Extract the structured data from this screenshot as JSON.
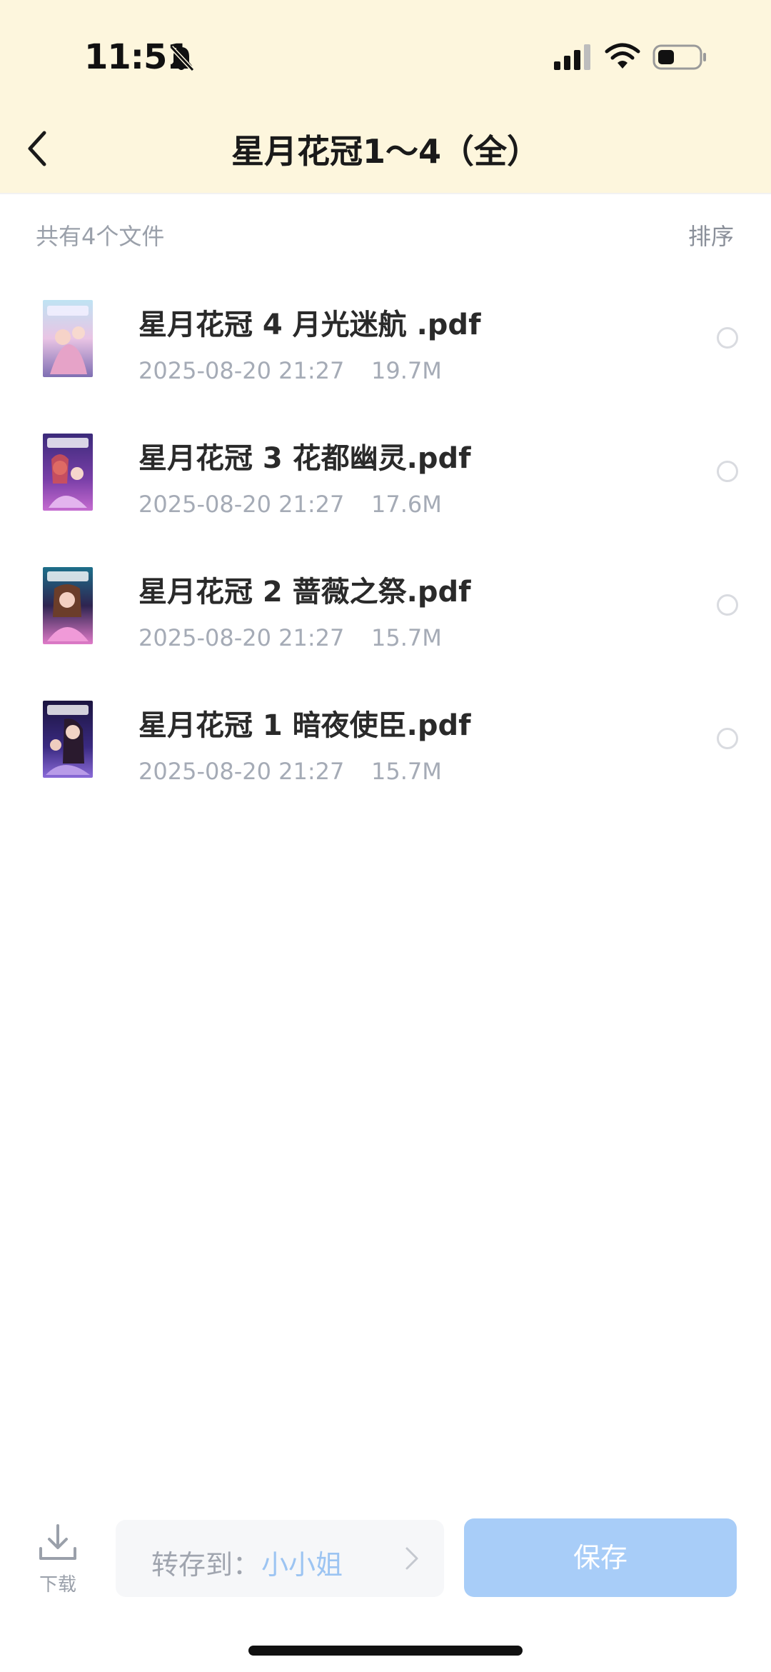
{
  "status_bar": {
    "time": "11:51",
    "icons": [
      "bell-slash-icon",
      "signal-icon",
      "wifi-icon",
      "battery-icon"
    ]
  },
  "header": {
    "title": "星月花冠1～4（全）",
    "back_icon": "chevron-left-icon",
    "background": "#fdf6dd"
  },
  "summary": {
    "file_count": "共有4个文件",
    "sort_label": "排序"
  },
  "files": [
    {
      "name": "星月花冠 4 月光迷航 .pdf",
      "date": "2025-08-20 21:27",
      "size": "19.7M",
      "selected": false
    },
    {
      "name": "星月花冠 3 花都幽灵.pdf",
      "date": "2025-08-20 21:27",
      "size": "17.6M",
      "selected": false
    },
    {
      "name": "星月花冠 2 蔷薇之祭.pdf",
      "date": "2025-08-20 21:27",
      "size": "15.7M",
      "selected": false
    },
    {
      "name": "星月花冠 1 暗夜使臣.pdf",
      "date": "2025-08-20 21:27",
      "size": "15.7M",
      "selected": false
    }
  ],
  "bottom_bar": {
    "download_label": "下载",
    "save_to_label": "转存到：",
    "save_to_value": "小小姐",
    "save_button": "保存",
    "accent_color": "#a8cdf8"
  }
}
